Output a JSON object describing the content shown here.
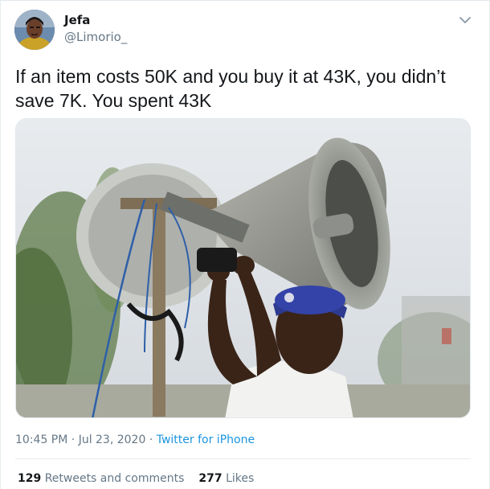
{
  "author": {
    "display_name": "Jefa",
    "handle": "@Limorio_",
    "avatar": "profile-photo"
  },
  "tweet": {
    "text": "If an item costs 50K and you buy it at 43K, you didn’t save 7K. You spent 43K",
    "media_description": "photo",
    "time": "10:45 PM",
    "separator1": " · ",
    "date": "Jul 23, 2020",
    "separator2": " · ",
    "source": "Twitter for iPhone"
  },
  "stats": {
    "retweets_count": "129",
    "retweets_label": "Retweets and comments",
    "likes_count": "277",
    "likes_label": "Likes"
  },
  "icons": {
    "menu": "chevron-down-icon"
  },
  "colors": {
    "text_primary": "#14171a",
    "text_secondary": "#657786",
    "link": "#1b95e0",
    "border": "#e6ecf0"
  }
}
